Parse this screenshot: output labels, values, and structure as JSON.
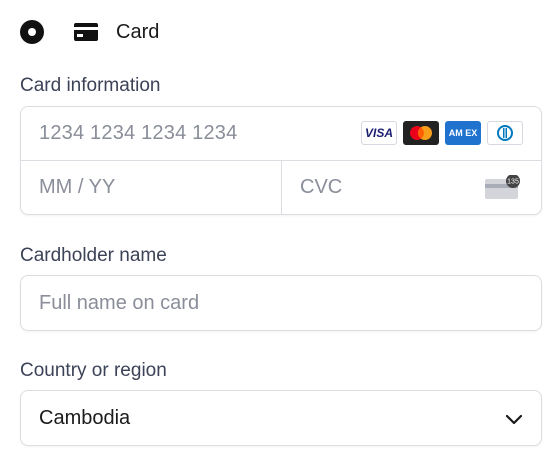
{
  "payment_method": {
    "label": "Card",
    "selected": true,
    "icon": "credit-card-icon"
  },
  "card_information": {
    "label": "Card information",
    "number_placeholder": "1234 1234 1234 1234",
    "expiry_placeholder": "MM / YY",
    "cvc_placeholder": "CVC",
    "brands": [
      {
        "name": "visa-icon",
        "text": "VISA"
      },
      {
        "name": "mastercard-icon"
      },
      {
        "name": "amex-icon",
        "text": "AM EX"
      },
      {
        "name": "diners-icon"
      }
    ],
    "cvc_icon_text": "135"
  },
  "cardholder": {
    "label": "Cardholder name",
    "placeholder": "Full name on card"
  },
  "country": {
    "label": "Country or region",
    "value": "Cambodia"
  },
  "colors": {
    "border": "#dcdde2",
    "placeholder": "#8a8e99",
    "label": "#3c4257",
    "visa": "#1a1f71",
    "amex": "#1f72cd",
    "mastercard_bg": "#222222"
  }
}
